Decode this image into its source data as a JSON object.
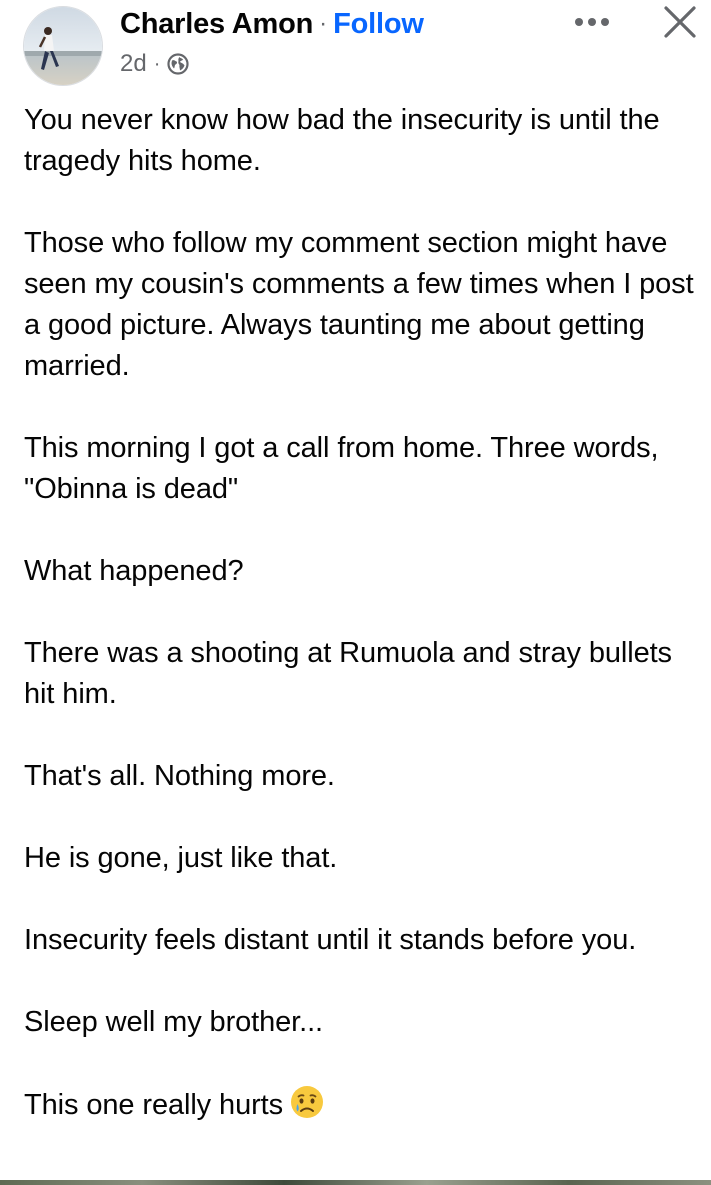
{
  "post": {
    "author": "Charles Amon",
    "separator": "·",
    "follow_label": "Follow",
    "timestamp": "2d",
    "meta_separator": "·",
    "audience_icon": "globe-icon",
    "more_icon": "more-horizontal-icon",
    "close_icon": "close-icon",
    "paragraphs": [
      "You never know how bad the insecurity is until the tragedy hits home.",
      "Those who follow my comment section might have seen my cousin's comments a few times when I post a good picture. Always taunting me about getting married.",
      "This morning I got a call from home. Three words, \"Obinna is dead\"",
      "What happened?",
      "There was a shooting at Rumuola and stray bullets hit him.",
      "That's all. Nothing more.",
      "He is gone, just like that.",
      "Insecurity feels distant until it stands before you.",
      "Sleep well my brother...",
      "This one really hurts"
    ],
    "final_emoji": "sad-but-relieved-face-emoji"
  },
  "colors": {
    "text": "#050505",
    "secondary": "#65676b",
    "follow": "#0866ff",
    "background": "#ffffff"
  }
}
